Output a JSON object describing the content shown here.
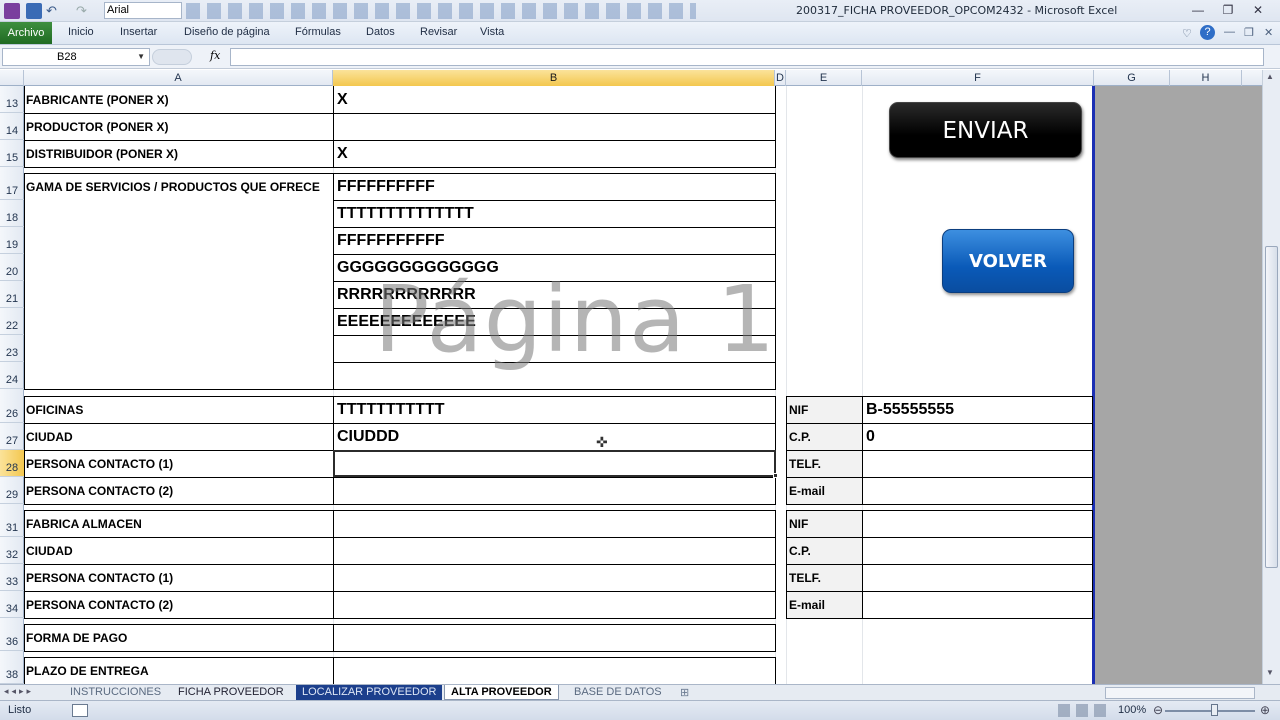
{
  "window": {
    "title": "200317_FICHA PROVEEDOR_OPCOM2432 - Microsoft Excel",
    "font_name": "Arial"
  },
  "ribbon": {
    "tabs": [
      "Archivo",
      "Inicio",
      "Insertar",
      "Diseño de página",
      "Fórmulas",
      "Datos",
      "Revisar",
      "Vista"
    ]
  },
  "formula_bar": {
    "name_box": "B28",
    "fx": "fx",
    "content": ""
  },
  "columns": [
    "A",
    "B",
    "D",
    "E",
    "F",
    "G",
    "H"
  ],
  "rows": [
    "13",
    "14",
    "15",
    "17",
    "18",
    "19",
    "20",
    "21",
    "22",
    "23",
    "24",
    "26",
    "27",
    "28",
    "29",
    "31",
    "32",
    "33",
    "34",
    "36",
    "38"
  ],
  "sheet": {
    "labels": {
      "r13": "FABRICANTE (PONER X)",
      "r14": "PRODUCTOR (PONER X)",
      "r15": "DISTRIBUIDOR (PONER X)",
      "r17": "GAMA DE SERVICIOS / PRODUCTOS QUE OFRECE",
      "r26": "OFICINAS",
      "r27": "CIUDAD",
      "r28": "PERSONA CONTACTO (1)",
      "r29": "PERSONA CONTACTO (2)",
      "r31": "FABRICA  ALMACEN",
      "r32": "CIUDAD",
      "r33": "PERSONA CONTACTO (1)",
      "r34": "PERSONA CONTACTO (2)",
      "r36": "FORMA DE PAGO",
      "r38": "PLAZO DE ENTREGA"
    },
    "values": {
      "r13": "X",
      "r15": "X",
      "r17": "FFFFFFFFFF",
      "r18": "TTTTTTTTTTTTTT",
      "r19": "FFFFFFFFFFF",
      "r20": "GGGGGGGGGGGGG",
      "r21": "RRRRRRRRRRRR",
      "r22": "EEEEEEEEEEEEE",
      "r26": "TTTTTTTTTTT",
      "r27": "CIUDDD"
    },
    "side_labels": {
      "r26": "NIF",
      "r27": "C.P.",
      "r28": "TELF.",
      "r29": "E-mail",
      "r31": "NIF",
      "r32": "C.P.",
      "r33": "TELF.",
      "r34": "E-mail"
    },
    "side_values": {
      "r26": "B-55555555",
      "r27": "0"
    },
    "watermark": "Página 1",
    "buttons": {
      "enviar": "ENVIAR",
      "volver": "VOLVER"
    }
  },
  "sheet_tabs": [
    "INSTRUCCIONES",
    "FICHA PROVEEDOR",
    "LOCALIZAR PROVEEDOR",
    "ALTA PROVEEDOR",
    "BASE DE DATOS"
  ],
  "active_sheet": "ALTA PROVEEDOR",
  "status": {
    "ready": "Listo",
    "zoom": "100%"
  }
}
